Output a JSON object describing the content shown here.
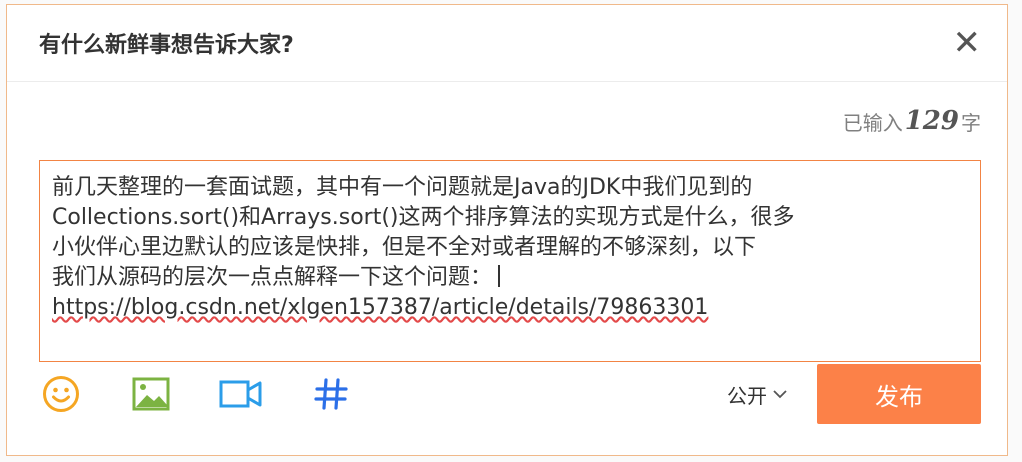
{
  "dialog": {
    "title": "有什么新鲜事想告诉大家?",
    "close_symbol": "✕"
  },
  "counter": {
    "prefix": "已输入",
    "count": "129",
    "suffix": "字"
  },
  "editor": {
    "lines": [
      "前几天整理的一套面试题，其中有一个问题就是Java的JDK中我们见到的",
      "Collections.sort()和Arrays.sort()这两个排序算法的实现方式是什么，很多",
      "小伙伴心里边默认的应该是快排，但是不全对或者理解的不够深刻，以下",
      "我们从源码的层次一点点解释一下这个问题："
    ],
    "link": "https://blog.csdn.net/xlgen157387/article/details/79863301"
  },
  "toolbar": {
    "tools": [
      "emoji-icon",
      "image-icon",
      "video-icon",
      "topic-icon"
    ],
    "visibility_label": "公开",
    "publish_label": "发布"
  },
  "colors": {
    "accent": "#fc8148",
    "editor_border": "#f28444",
    "emoji": "#f5a623",
    "image": "#7cb342",
    "video": "#2b9de9",
    "topic": "#2b6fe8"
  }
}
